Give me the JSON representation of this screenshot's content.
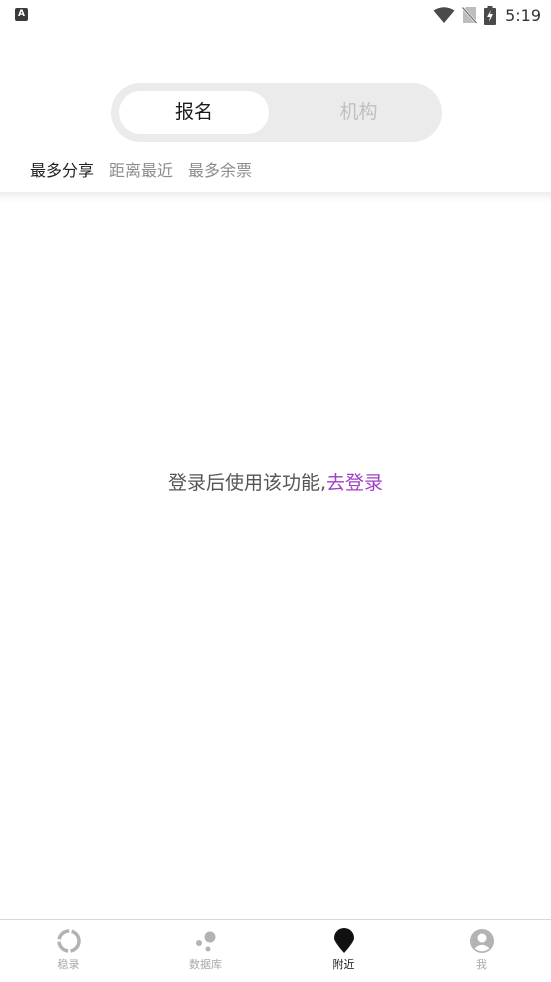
{
  "status_bar": {
    "left_icon": "A",
    "time": "5:19",
    "icons": [
      "wifi-icon",
      "no-sim-icon",
      "battery-charging-icon"
    ]
  },
  "segmented": {
    "active_label": "报名",
    "inactive_label": "机构"
  },
  "filter_tabs": [
    {
      "label": "最多分享",
      "active": true
    },
    {
      "label": "距离最近",
      "active": false
    },
    {
      "label": "最多余票",
      "active": false
    }
  ],
  "empty_state": {
    "message": "登录后使用该功能,",
    "link_label": "去登录",
    "link_color": "#9d3fc9"
  },
  "bottom_nav": [
    {
      "label": "稳录",
      "icon": "ring-icon",
      "active": false
    },
    {
      "label": "数据库",
      "icon": "dots-icon",
      "active": false
    },
    {
      "label": "附近",
      "icon": "location-pin-icon",
      "active": true
    },
    {
      "label": "我",
      "icon": "user-icon",
      "active": false
    }
  ]
}
